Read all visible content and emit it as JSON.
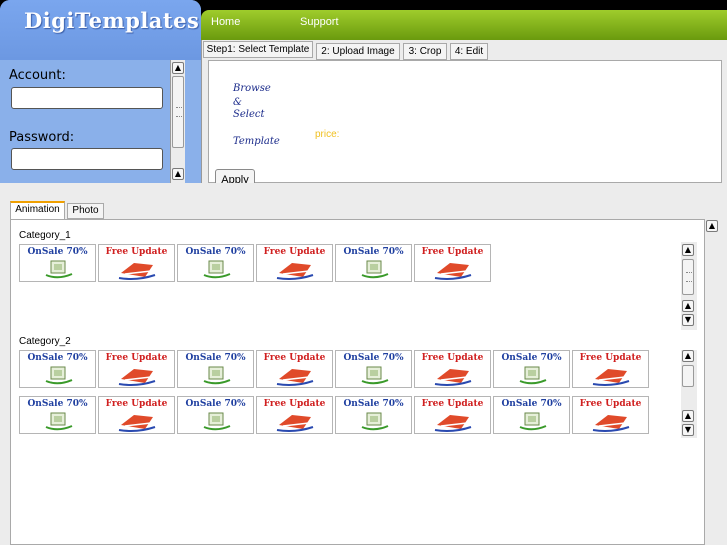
{
  "logo": {
    "text": "DigiTemplates"
  },
  "login": {
    "account_label": "Account:",
    "password_label": "Password:",
    "account_value": "",
    "password_value": ""
  },
  "nav": {
    "items": [
      "Home",
      "Support"
    ]
  },
  "wizard": {
    "tabs": [
      "Step1: Select Template",
      "2: Upload Image",
      "3: Crop",
      "4: Edit"
    ],
    "active_tab": 0,
    "browse_lines": [
      "Browse",
      "&",
      "Select"
    ],
    "template_label": "Template",
    "price_label": "price:",
    "apply_label": "Apply"
  },
  "gallery": {
    "tabs": [
      "Animation",
      "Photo"
    ],
    "active_tab": 0,
    "categories": [
      {
        "name": "Category_1",
        "rows": [
          [
            "sale",
            "free",
            "sale",
            "free",
            "sale",
            "free"
          ]
        ]
      },
      {
        "name": "Category_2",
        "rows": [
          [
            "sale",
            "free",
            "sale",
            "free",
            "sale",
            "free",
            "sale",
            "free"
          ],
          [
            "sale",
            "free",
            "sale",
            "free",
            "sale",
            "free",
            "sale",
            "free"
          ]
        ]
      }
    ],
    "thumb_titles": {
      "sale": "OnSale 70%",
      "free": "Free Update"
    }
  },
  "colors": {
    "nav_green": "#7fb01a",
    "logo_blue": "#7aa6ee",
    "tab_accent": "#f0a000",
    "price_yellow": "#f0c020"
  }
}
